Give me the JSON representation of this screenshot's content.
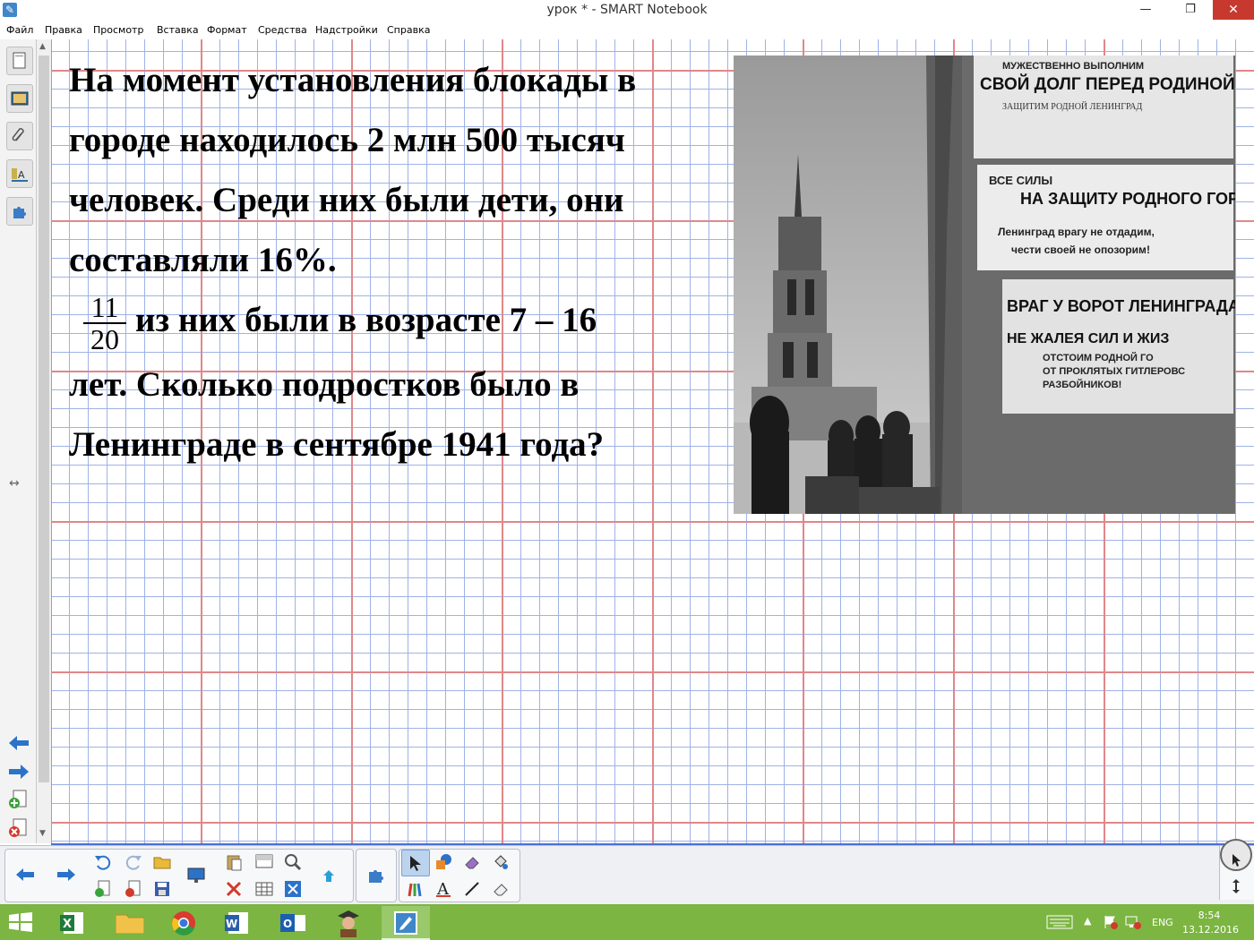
{
  "window": {
    "title": "урок * - SMART Notebook",
    "minimize": "—",
    "restore": "❐",
    "close": "✕"
  },
  "menu": [
    "Файл",
    "Правка",
    "Просмотр",
    "Вставка",
    "Формат",
    "Средства",
    "Надстройки",
    "Справка"
  ],
  "question": {
    "line1": "На момент установления блокады в",
    "line2": "городе находилось 2 млн 500 тысяч",
    "line3": "человек. Среди них были дети, они",
    "line4": "составляли 16%.",
    "fraction_numerator": "11",
    "fraction_denominator": "20",
    "line5": "из них были в возрасте 7 – 16",
    "line6": "лет. Сколько подростков было в",
    "line7": "Ленинграде в сентябре 1941 года?"
  },
  "photo_posters": {
    "p1": "МУЖЕСТВЕННО ВЫПОЛНИМ",
    "p2": "СВОЙ ДОЛГ ПЕРЕД РОДИНОЙ!",
    "p3": "ЗАЩИТИМ РОДНОЙ ЛЕНИНГРАД",
    "p4": "ВСЕ СИЛЫ",
    "p5": "НА ЗАЩИТУ РОДНОГО ГОРОДА",
    "p6": "Ленинград врагу не отдадим,",
    "p7": "чести своей не опозорим!",
    "p8": "ВРАГ У ВОРОТ ЛЕНИНГРАДА",
    "p9": "НЕ ЖАЛЕЯ СИЛ И ЖИЗ",
    "p10": "ОТСТОИМ РОДНОЙ ГО",
    "p11": "ОТ ПРОКЛЯТЫХ ГИТЛЕРОВС",
    "p12": "РАЗБОЙНИКОВ!"
  },
  "taskbar": {
    "language": "ENG",
    "time": "8:54",
    "date": "13.12.2016"
  },
  "colors": {
    "grid_major": "#e0878a",
    "grid_minor": "#9fb2e6",
    "taskbar": "#7cb542"
  }
}
